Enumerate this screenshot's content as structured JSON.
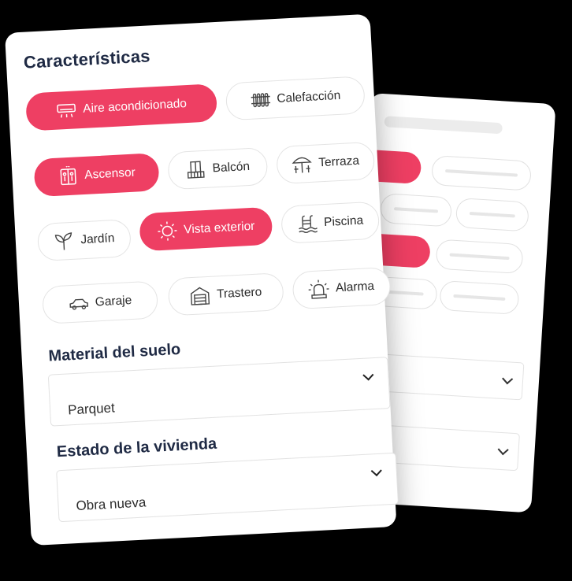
{
  "section_title": "Características",
  "features": [
    {
      "label": "Aire acondicionado",
      "icon": "air-conditioner-icon",
      "selected": true
    },
    {
      "label": "Calefacción",
      "icon": "radiator-icon",
      "selected": false
    },
    {
      "label": "Ascensor",
      "icon": "elevator-icon",
      "selected": true
    },
    {
      "label": "Balcón",
      "icon": "balcony-icon",
      "selected": false
    },
    {
      "label": "Terraza",
      "icon": "terrace-umbrella-icon",
      "selected": false
    },
    {
      "label": "Jardín",
      "icon": "plant-icon",
      "selected": false
    },
    {
      "label": "Vista exterior",
      "icon": "sun-icon",
      "selected": true
    },
    {
      "label": "Piscina",
      "icon": "pool-icon",
      "selected": false
    },
    {
      "label": "Garaje",
      "icon": "car-icon",
      "selected": false
    },
    {
      "label": "Trastero",
      "icon": "storage-room-icon",
      "selected": false
    },
    {
      "label": "Alarma",
      "icon": "alarm-siren-icon",
      "selected": false
    }
  ],
  "floor_material": {
    "label": "Material del suelo",
    "value": "Parquet",
    "icon": "chevron-down-icon"
  },
  "home_condition": {
    "label": "Estado de la vivienda",
    "value": "Obra nueva",
    "icon": "chevron-down-icon"
  },
  "colors": {
    "accent": "#ee3f63",
    "text_dark": "#1f2a44",
    "border": "#e4e4e4"
  }
}
